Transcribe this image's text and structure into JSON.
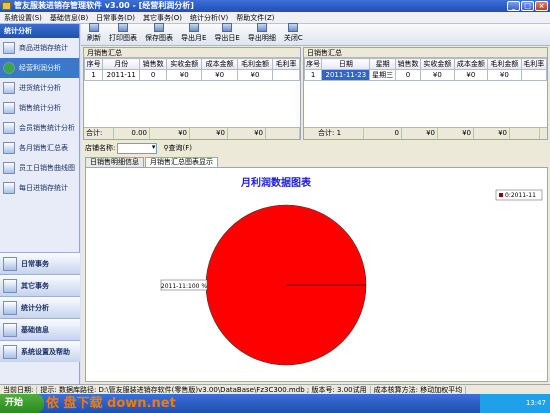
{
  "window": {
    "title": "管友服装进销存管理软件 v3.00 - [经营利润分析]"
  },
  "menu": [
    "系统设置(S)",
    "基础信息(B)",
    "日常事务(D)",
    "其它事务(O)",
    "统计分析(V)",
    "帮助文件(Z)"
  ],
  "toolbar": [
    "刷新",
    "打印图表",
    "保存图表",
    "导出月E",
    "导出日E",
    "导出明细",
    "关闭C"
  ],
  "sidebar": {
    "section": "统计分析",
    "items": [
      "商品进销存统计",
      "经营利润分析",
      "进货统计分析",
      "销售统计分析",
      "会员销售统计分析",
      "各月销售汇总表",
      "员工日销售曲线图",
      "每日进销存统计"
    ],
    "groups": [
      "日常事务",
      "其它事务",
      "统计分析",
      "基础信息",
      "系统设置及帮助"
    ]
  },
  "monthly": {
    "title": "月销售汇总",
    "columns": [
      "序号",
      "月份",
      "销售数",
      "实收金额",
      "成本金额",
      "毛利金额",
      "毛利率"
    ],
    "rows": [
      [
        "1",
        "2011-11",
        "0",
        "¥0",
        "¥0",
        "¥0",
        ""
      ]
    ],
    "totals": [
      "合计: ",
      "0.00",
      "¥0",
      "¥0",
      "¥0",
      ""
    ]
  },
  "daily": {
    "title": "日销售汇总",
    "columns": [
      "序号",
      "日期",
      "星期",
      "销售数",
      "实收金额",
      "成本金额",
      "毛利金额",
      "毛利率"
    ],
    "rows": [
      [
        "1",
        "2011-11-23",
        "星期三",
        "0",
        "¥0",
        "¥0",
        "¥0",
        ""
      ]
    ],
    "totals": [
      "合计: 1",
      "0",
      "¥0",
      "¥0",
      "¥0",
      ""
    ]
  },
  "filter": {
    "store_label": "店铺名称:",
    "query": "查询(F)"
  },
  "tabs": [
    "日销售明细信息",
    "月销售汇总图表显示"
  ],
  "chart_data": {
    "type": "pie",
    "title": "月利润数据图表",
    "categories": [
      "2011-11"
    ],
    "values": [
      100
    ],
    "slice_label": "2011-11:100 %",
    "legend": [
      "0:2011-11"
    ],
    "legend_position": "top-right",
    "colors": [
      "#ff0000"
    ]
  },
  "status": [
    "当前日期:",
    "提示: 数据库路径: D:\\管友服装进销存软件(零售版)v3.00\\DataBase\\Fz3C300.mdb ; 版本号: 3.00试用",
    "成本核算方法: 移动加权平均"
  ],
  "taskbar": {
    "start": "开始",
    "time": "13:47"
  },
  "watermark": "依 盘下载 down.net"
}
